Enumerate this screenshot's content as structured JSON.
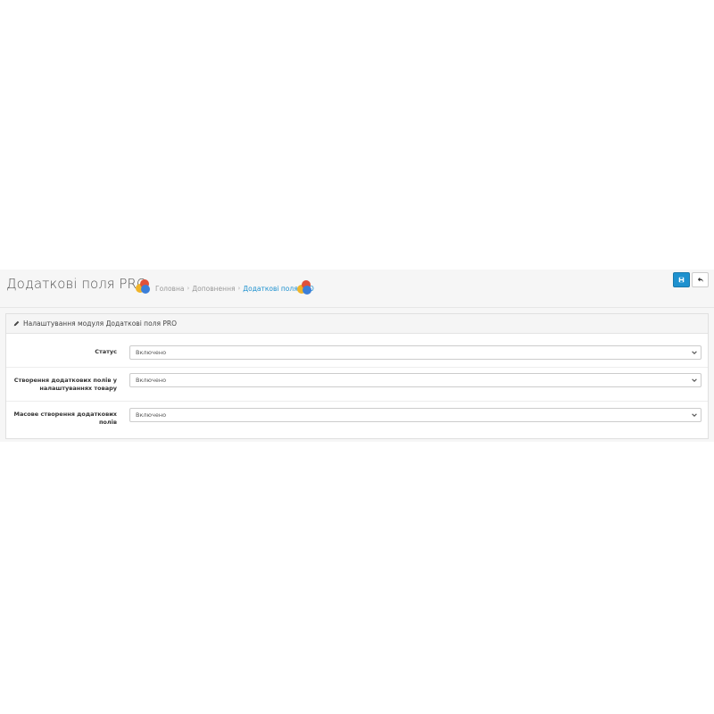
{
  "header": {
    "title": "Додаткові поля PRO",
    "breadcrumb": [
      "Головна",
      "Доповнення",
      "Додаткові поля PRO"
    ]
  },
  "toolbar": {
    "save_icon": "save-icon",
    "back_icon": "reply-icon"
  },
  "panel": {
    "heading": "Налаштування модуля Додаткові поля PRO",
    "fields": [
      {
        "label": "Статус",
        "value": "Включено"
      },
      {
        "label": "Створення додаткових полів у налаштуваннях товару",
        "value": "Включено"
      },
      {
        "label": "Масове створення додаткових полів",
        "value": "Включено"
      }
    ]
  },
  "colors": {
    "accent": "#1e91cf",
    "background": "#f6f6f6"
  }
}
